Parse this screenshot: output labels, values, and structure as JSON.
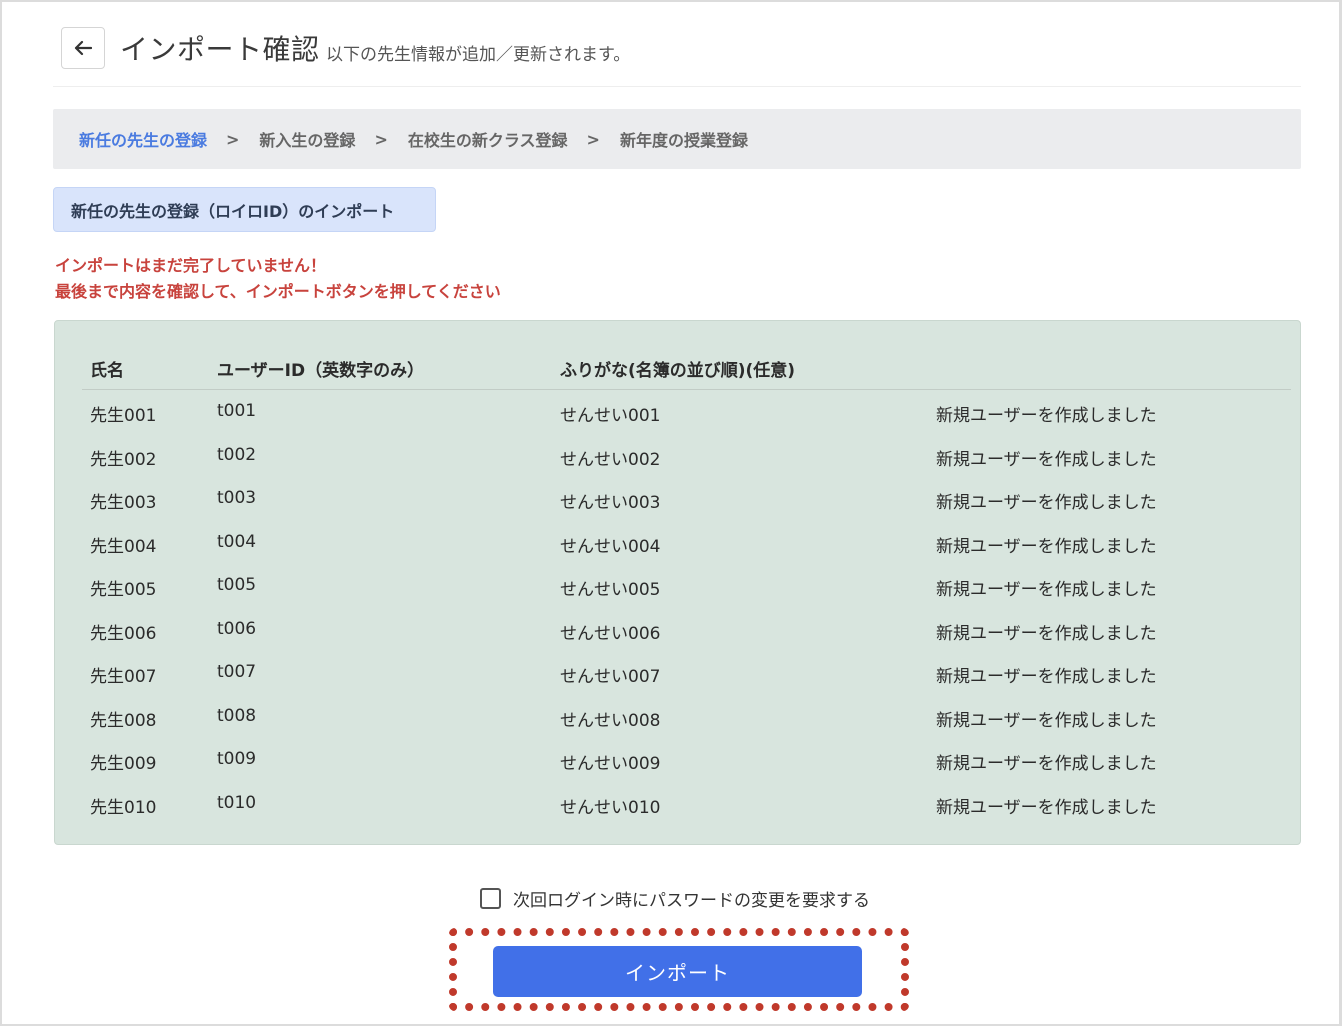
{
  "header": {
    "back_icon": "arrow-left-icon",
    "title": "インポート確認",
    "subtitle": "以下の先生情報が追加／更新されます。"
  },
  "breadcrumb": {
    "items": [
      {
        "label": "新任の先生の登録",
        "active": true
      },
      {
        "label": "新入生の登録",
        "active": false
      },
      {
        "label": "在校生の新クラス登録",
        "active": false
      },
      {
        "label": "新年度の授業登録",
        "active": false
      }
    ],
    "separator": ">"
  },
  "section": {
    "badge": "新任の先生の登録（ロイロID）のインポート"
  },
  "warnings": {
    "line1": "インポートはまだ完了していません！",
    "line2": "最後まで内容を確認して、インポートボタンを押してください"
  },
  "table": {
    "columns": [
      "氏名",
      "ユーザーID（英数字のみ）",
      "ふりがな(名簿の並び順)(任意)",
      ""
    ],
    "rows": [
      [
        "先生001",
        "t001",
        "せんせい001",
        "新規ユーザーを作成しました"
      ],
      [
        "先生002",
        "t002",
        "せんせい002",
        "新規ユーザーを作成しました"
      ],
      [
        "先生003",
        "t003",
        "せんせい003",
        "新規ユーザーを作成しました"
      ],
      [
        "先生004",
        "t004",
        "せんせい004",
        "新規ユーザーを作成しました"
      ],
      [
        "先生005",
        "t005",
        "せんせい005",
        "新規ユーザーを作成しました"
      ],
      [
        "先生006",
        "t006",
        "せんせい006",
        "新規ユーザーを作成しました"
      ],
      [
        "先生007",
        "t007",
        "せんせい007",
        "新規ユーザーを作成しました"
      ],
      [
        "先生008",
        "t008",
        "せんせい008",
        "新規ユーザーを作成しました"
      ],
      [
        "先生009",
        "t009",
        "せんせい009",
        "新規ユーザーを作成しました"
      ],
      [
        "先生010",
        "t010",
        "せんせい010",
        "新規ユーザーを作成しました"
      ]
    ]
  },
  "options": {
    "require_password_change_label": "次回ログイン時にパスワードの変更を要求する",
    "require_password_change_checked": false
  },
  "actions": {
    "import_label": "インポート"
  },
  "colors": {
    "accent": "#4170e8",
    "breadcrumb_active": "#4a7be0",
    "warning": "#c8433d",
    "panel_bg": "#d8e5de",
    "highlight": "#c0392b"
  }
}
